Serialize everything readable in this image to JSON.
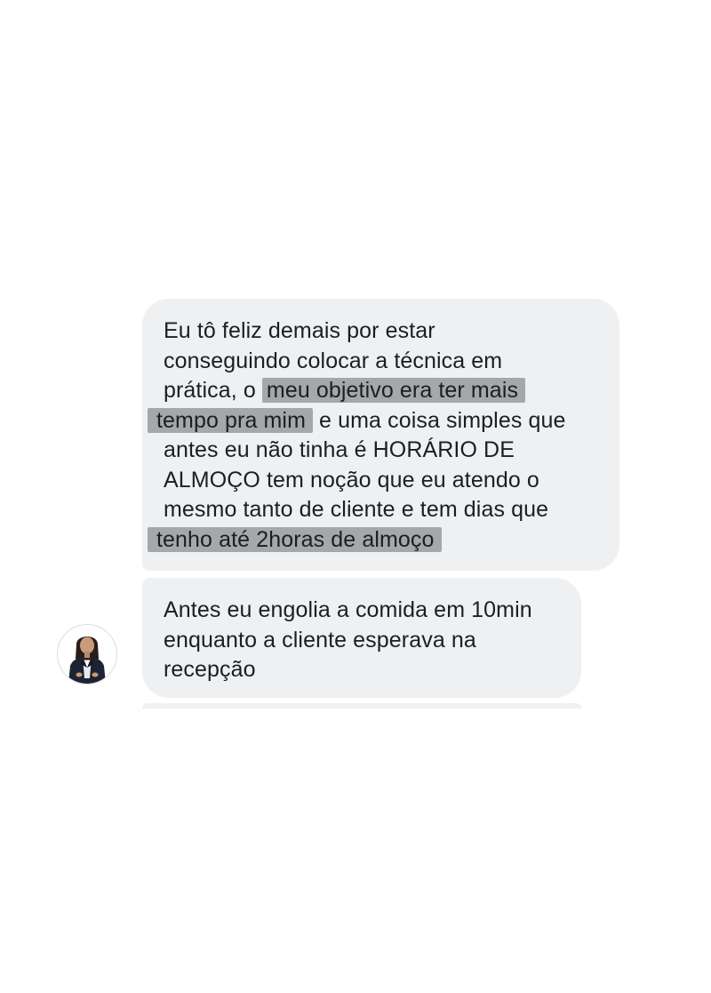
{
  "messages": [
    {
      "lines": [
        {
          "text": "Eu tô feliz demais por estar"
        },
        {
          "text": "conseguindo colocar a técnica em"
        },
        {
          "before": "prática, o ",
          "highlight": "meu objetivo era ter mais"
        },
        {
          "highlight": "tempo pra mim",
          "after": " e uma coisa simples que"
        },
        {
          "text": "antes eu não tinha é HORÁRIO DE"
        },
        {
          "text": "ALMOÇO tem noção que eu atendo o"
        },
        {
          "text": "mesmo tanto de cliente e tem dias que"
        },
        {
          "highlight": "tenho até 2horas de almoço"
        }
      ]
    },
    {
      "lines": [
        {
          "text": "Antes eu engolia a comida em 10min"
        },
        {
          "text": "enquanto a cliente esperava na"
        },
        {
          "text": "recepção"
        }
      ]
    }
  ],
  "colors": {
    "bubble": "#eff0f2",
    "highlight": "#a6a7a9",
    "text": "#1c1e21"
  },
  "avatar": {
    "icon": "profile-photo-woman-dark-blazer"
  }
}
